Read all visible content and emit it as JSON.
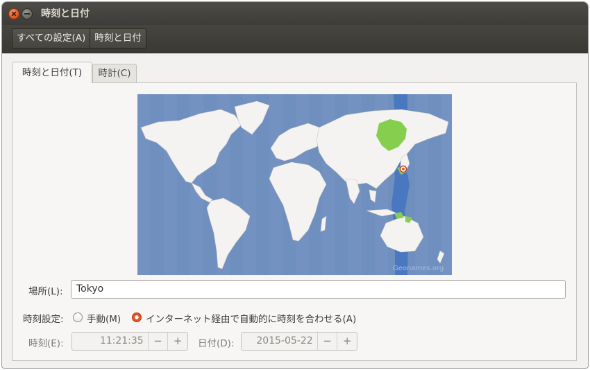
{
  "window": {
    "title": "時刻と日付"
  },
  "toolbar": {
    "breadcrumbs": [
      "すべての設定(A)",
      "時刻と日付"
    ]
  },
  "tabs": [
    {
      "label": "時刻と日付(T)",
      "active": true
    },
    {
      "label": "時計(C)",
      "active": false
    }
  ],
  "map": {
    "attribution": "Geonames.org",
    "selected_city": "Tokyo"
  },
  "location": {
    "label": "場所(L):",
    "value": "Tokyo"
  },
  "time_setting": {
    "label": "時刻設定:",
    "options": [
      {
        "label": "手動(M)",
        "selected": false
      },
      {
        "label": "インターネット経由で自動的に時刻を合わせる(A)",
        "selected": true
      }
    ]
  },
  "time": {
    "label": "時刻(E):",
    "value": "11:21:35",
    "minus": "−",
    "plus": "+"
  },
  "date": {
    "label": "日付(D):",
    "value": "2015-05-22",
    "minus": "−",
    "plus": "+"
  },
  "colors": {
    "ocean": "#6f8fbf",
    "land": "#f4f3f1",
    "highlight_tz": "#4a78c0",
    "highlight_land": "#86cf4e",
    "accent": "#e3541e"
  }
}
